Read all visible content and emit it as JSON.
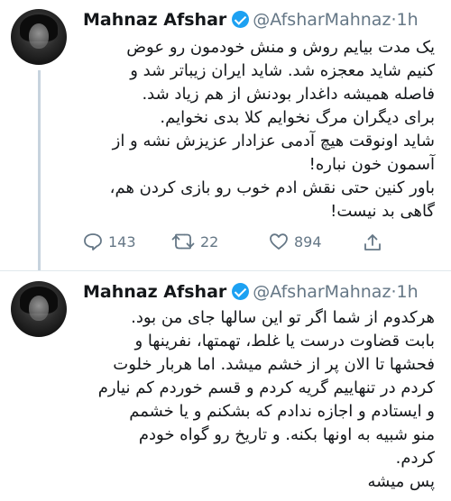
{
  "tweets": [
    {
      "name": "Mahnaz Afshar",
      "handle": "@AfsharMahnaz",
      "dot": "·",
      "time": "1h",
      "lines": [
        "یک مدت بیایم روش و منش خودمون رو عوض",
        "کنیم شاید معجزه شد. شاید ایران زیباتر شد و",
        "فاصله همیشه داغدار بودنش از هم زیاد شد.",
        "برای دیگران مرگ نخوایم کلا بدی نخوایم.",
        "شاید اونوقت هیچ آدمی عزادار عزیزش نشه و از",
        "آسمون خون نباره!",
        "باور کنین حتی نقش ادم خوب رو بازی کردن هم،",
        "گاهی بد نیست!"
      ],
      "actions": {
        "replies": "143",
        "retweets": "22",
        "likes": "894"
      }
    },
    {
      "name": "Mahnaz Afshar",
      "handle": "@AfsharMahnaz",
      "dot": "·",
      "time": "1h",
      "lines": [
        "هرکدوم از شما اگر تو این سالها جای من بود.",
        "بابت قضاوت درست یا غلط، تهمتها، نفرینها و",
        "فحشها تا الان پر از خشم میشد. اما هربار خلوت",
        "کردم در تنهاییم گریه کردم و قسم خوردم کم نیارم",
        "و ایستادم و اجازه ندادم که بشکنم و یا خشمم",
        "منو شبیه به اونها بکنه. و تاریخ رو گواه خودم",
        "کردم.",
        "پس میشه"
      ]
    }
  ],
  "icons": {
    "reply": "reply-icon",
    "retweet": "retweet-icon",
    "like": "like-icon",
    "share": "share-icon",
    "verified": "verified-badge-icon"
  },
  "colors": {
    "verified": "#1da1f2",
    "secondary_text": "#657786",
    "primary_text": "#14171a",
    "thread_line": "#c7d3de"
  }
}
